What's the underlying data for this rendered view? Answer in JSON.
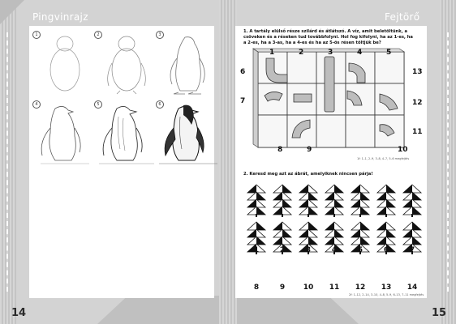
{
  "left_page": {
    "title": "Pingvinrajz",
    "page_number": "14",
    "steps": [
      "1",
      "2",
      "3",
      "4",
      "5",
      "6"
    ]
  },
  "right_page": {
    "title": "Fejtörő",
    "page_number": "15",
    "task1": {
      "text": "1. A tartály elülső része szilárd és átlátszó. A víz, amit beletöltünk, a csöveken és a réseken tud továbbfolyni. Hol fog kifolyni, ha az 1-es, ha a 2-es, ha a 3-as, ha a 4-es és ha az 5-ös résen töltjük be?",
      "top_labels": [
        "1",
        "2",
        "3",
        "4",
        "5"
      ],
      "left_labels": [
        "6",
        "7"
      ],
      "right_labels": [
        "13",
        "12",
        "11"
      ],
      "bottom_labels": [
        "8",
        "9",
        "10"
      ],
      "answer_ref": "1f: 1–1, 2–9, 3–8, 4–7, 5–6 megfejtés"
    },
    "task2": {
      "text": "2. Keresd meg azt az ábrát, amelyiknek nincsen párja!",
      "row1_labels": [
        "1",
        "2",
        "3",
        "4",
        "5",
        "6",
        "7"
      ],
      "row2_labels": [
        "8",
        "9",
        "10",
        "11",
        "12",
        "13",
        "14"
      ],
      "answer_ref": "2f: 1–12, 2–14, 3–10, 4–8, 5–9, 6–13, 7–11 megfejtés"
    }
  }
}
